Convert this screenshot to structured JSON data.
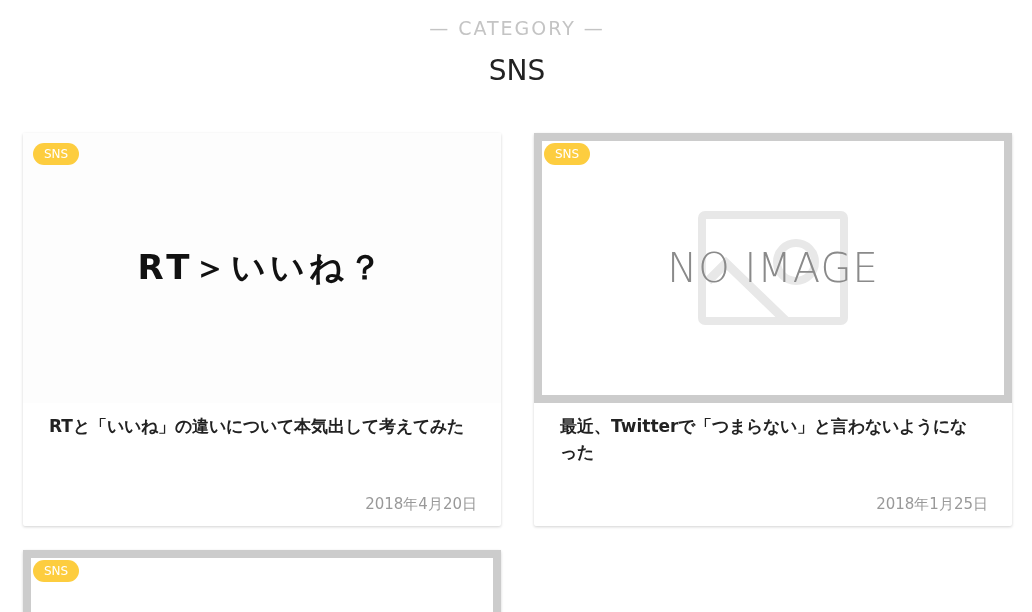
{
  "header": {
    "eyebrow": "— CATEGORY —",
    "title": "SNS"
  },
  "cards": [
    {
      "badge": "SNS",
      "thumbnail": {
        "kind": "image",
        "text": "RT＞いいね？"
      },
      "title": "RTと「いいね」の違いについて本気出して考えてみた",
      "date": "2018年4月20日"
    },
    {
      "badge": "SNS",
      "thumbnail": {
        "kind": "no_image",
        "text": "NO IMAGE"
      },
      "title": "最近、Twitterで「つまらない」と言わないようになった",
      "date": "2018年1月25日"
    },
    {
      "badge": "SNS",
      "thumbnail": {
        "kind": "no_image"
      }
    }
  ]
}
